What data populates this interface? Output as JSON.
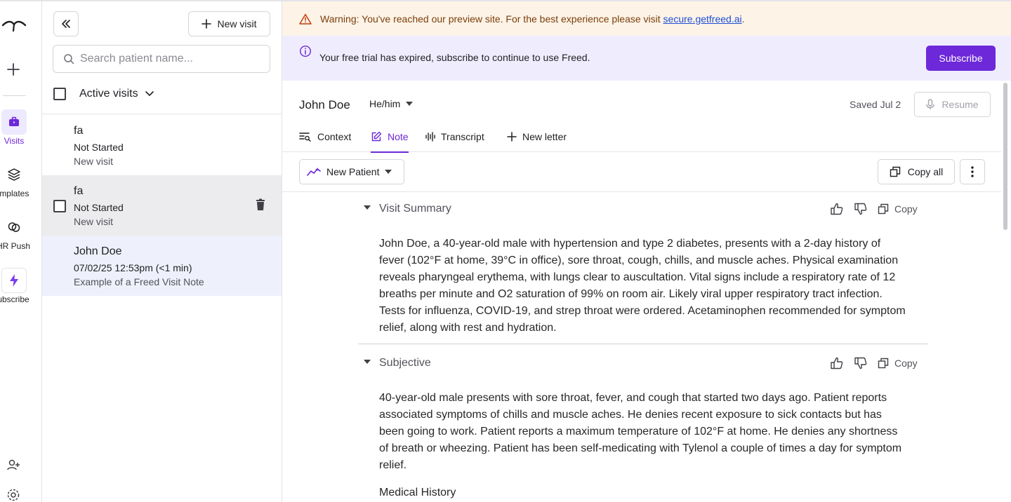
{
  "rail": {
    "items": [
      {
        "label": "Visits",
        "icon": "briefcase-icon"
      },
      {
        "label": "Templates",
        "icon": "layers-icon"
      },
      {
        "label": "EHR Push",
        "icon": "link-icon"
      },
      {
        "label": "Subscribe",
        "icon": "bolt-icon"
      }
    ]
  },
  "panel": {
    "new_visit_label": "New visit",
    "search_placeholder": "Search patient name...",
    "filter_label": "Active visits",
    "visits": [
      {
        "name": "fa",
        "status": "Not Started",
        "subtitle": "New visit"
      },
      {
        "name": "fa",
        "status": "Not Started",
        "subtitle": "New visit"
      },
      {
        "name": "John Doe",
        "status": "07/02/25 12:53pm (<1 min)",
        "subtitle": "Example of a Freed Visit Note"
      }
    ]
  },
  "banner": {
    "warning_text": "Warning: You've reached our preview site. For the best experience please visit ",
    "warning_link": "secure.getfreed.ai",
    "warning_tail": ".",
    "trial_text": "Your free trial has expired, subscribe to continue to use Freed.",
    "subscribe_label": "Subscribe"
  },
  "header": {
    "patient_name": "John Doe",
    "pronouns": "He/him",
    "saved": "Saved Jul 2",
    "resume_label": "Resume"
  },
  "tabs": [
    {
      "label": "Context"
    },
    {
      "label": "Note"
    },
    {
      "label": "Transcript"
    },
    {
      "label": "New letter"
    }
  ],
  "toolbar": {
    "template_label": "New Patient",
    "copy_all_label": "Copy all"
  },
  "sections": [
    {
      "title": "Visit Summary",
      "copy_label": "Copy",
      "body": "John Doe, a 40-year-old male with hypertension and type 2 diabetes, presents with a 2-day history of fever (102°F at home, 39°C in office), sore throat, cough, chills, and muscle aches. Physical examination reveals pharyngeal erythema, with lungs clear to auscultation. Vital signs include a respiratory rate of 12 breaths per minute and O2 saturation of 99% on room air. Likely viral upper respiratory tract infection. Tests for influenza, COVID-19, and strep throat were ordered. Acetaminophen recommended for symptom relief, along with rest and hydration."
    },
    {
      "title": "Subjective",
      "copy_label": "Copy",
      "body": "40-year-old male presents with sore throat, fever, and cough that started two days ago. Patient reports associated symptoms of chills and muscle aches. He denies recent exposure to sick contacts but has been going to work. Patient reports a maximum temperature of 102°F at home. He denies any shortness of breath or wheezing. Patient has been self-medicating with Tylenol a couple of times a day for symptom relief.",
      "subheading": "Medical History"
    }
  ],
  "colors": {
    "accent": "#6d28d9",
    "warning_bg": "#fdf3e7",
    "trial_bg": "#efedfd",
    "selected_bg": "#eef0fb"
  }
}
